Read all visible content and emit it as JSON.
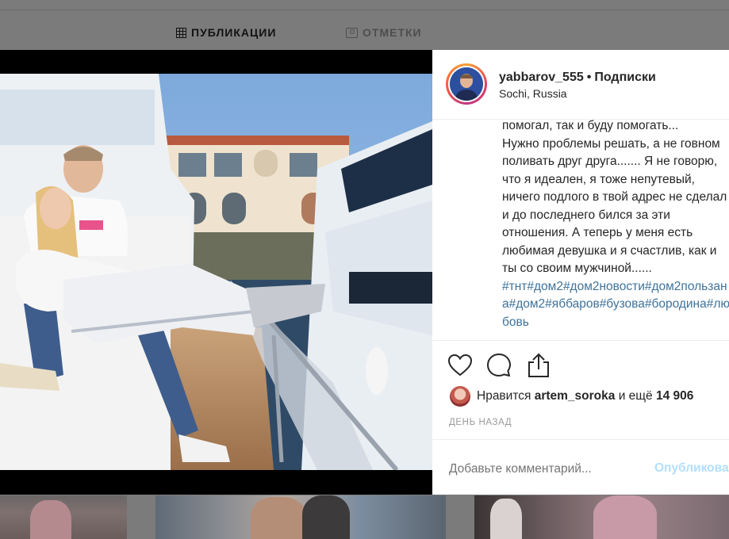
{
  "profile_tabs": [
    {
      "label": "ПУБЛИКАЦИИ",
      "icon": "grid-icon",
      "active": true
    },
    {
      "label": "ОТМЕТКИ",
      "icon": "tag-icon",
      "active": false
    }
  ],
  "post": {
    "username": "yabbarov_555",
    "separator": "•",
    "follow_label": "Подписки",
    "location": "Sochi, Russia",
    "caption": "помогал, так и буду помогать...\nНужно проблемы решать, а не говном поливать друг друга....... Я не говорю, что я идеален, я тоже непутевый, ничего подлого в твой адрес не сделал и до последнего бился за эти отношения. А теперь у меня есть любимая девушка и я счастлив, как и ты со своим мужчиной......",
    "hashtags": "#тнт#дом2#дом2новости#дом2пользана#дом2#яббаров#бузова#бородина#любовь",
    "likes_prefix": "Нравится",
    "likes_user": "artem_soroka",
    "likes_middle": "и ещё",
    "likes_count": "14 906",
    "timestamp": "ДЕНЬ НАЗАД",
    "comment_placeholder": "Добавьте комментарий...",
    "publish_label": "Опубликовать"
  },
  "icons": {
    "like": "heart-icon",
    "comment": "comment-icon",
    "share": "share-icon"
  },
  "colors": {
    "link": "#3f729b",
    "publish_disabled": "#b2dffc",
    "muted": "#999999",
    "text": "#262626"
  }
}
